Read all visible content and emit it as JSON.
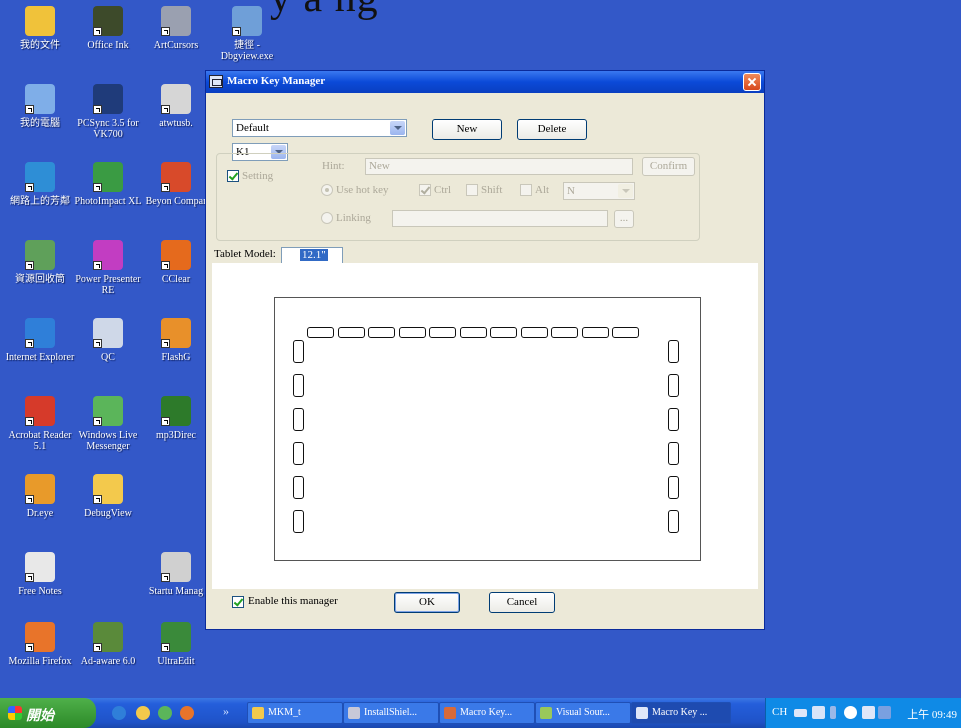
{
  "capture_top_text": "y a ng",
  "desktop_icons": [
    {
      "label": "我的文件",
      "icon": "my-documents-icon",
      "color": "#f0c23a"
    },
    {
      "label": "Office Ink",
      "icon": "office-ink-icon",
      "color": "#3d4a2a"
    },
    {
      "label": "ArtCursors",
      "icon": "artcursors-icon",
      "color": "#9aa0b0"
    },
    {
      "label": "捷徑 - Dbgview.exe",
      "icon": "dbgview-icon",
      "color": "#6f9fd8"
    },
    {
      "label": "我的電腦",
      "icon": "my-computer-icon",
      "color": "#7faee8"
    },
    {
      "label": "PCSync 3.5 for VK700",
      "icon": "pcsync-icon",
      "color": "#1f3b7a"
    },
    {
      "label": "atwtusb.",
      "icon": "atwtusb-icon",
      "color": "#d6d6d6"
    },
    {
      "label": "網路上的芳鄰",
      "icon": "network-places-icon",
      "color": "#2e8ed6"
    },
    {
      "label": "PhotoImpact XL",
      "icon": "photoimpact-icon",
      "color": "#3a9b43"
    },
    {
      "label": "Beyon Compar",
      "icon": "beyond-compare-icon",
      "color": "#d84a2a"
    },
    {
      "label": "資源回收筒",
      "icon": "recycle-bin-icon",
      "color": "#5fa05a"
    },
    {
      "label": "Power Presenter RE",
      "icon": "power-presenter-icon",
      "color": "#c23dc2"
    },
    {
      "label": "CClear",
      "icon": "ccleaner-icon",
      "color": "#e56a1d"
    },
    {
      "label": "Internet Explorer",
      "icon": "internet-explorer-icon",
      "color": "#2f7fd9"
    },
    {
      "label": "QC",
      "icon": "qc-icon",
      "color": "#cfd8e8"
    },
    {
      "label": "FlashG",
      "icon": "flashget-icon",
      "color": "#e8902a"
    },
    {
      "label": "Acrobat Reader 5.1",
      "icon": "acrobat-reader-icon",
      "color": "#d63a2a"
    },
    {
      "label": "Windows Live Messenger",
      "icon": "messenger-icon",
      "color": "#5bb55a"
    },
    {
      "label": "mp3Direc",
      "icon": "mp3directcut-icon",
      "color": "#2d7a2a"
    },
    {
      "label": "Dr.eye",
      "icon": "dreye-icon",
      "color": "#e89a2a"
    },
    {
      "label": "DebugView",
      "icon": "folder-icon",
      "color": "#f3c94c"
    },
    {
      "label": "Free Notes",
      "icon": "free-notes-icon",
      "color": "#e8e8e8"
    },
    {
      "label": "Startu Manag",
      "icon": "startup-manager-icon",
      "color": "#d0d0d0"
    },
    {
      "label": "Mozilla Firefox",
      "icon": "firefox-icon",
      "color": "#e8742a"
    },
    {
      "label": "Ad-aware 6.0",
      "icon": "adaware-icon",
      "color": "#5a8a3a"
    },
    {
      "label": "UltraEdit",
      "icon": "ultraedit-icon",
      "color": "#3a8a3a"
    }
  ],
  "dialog": {
    "title": "Macro Key Manager",
    "profile_value": "Default",
    "new_label": "New",
    "delete_label": "Delete",
    "key_value": "K1",
    "setting_label": "Setting",
    "setting_checked": true,
    "hint_label": "Hint:",
    "hint_value": "New",
    "confirm_label": "Confirm",
    "use_hot_key_label": "Use hot key",
    "ctrl_label": "Ctrl",
    "ctrl_checked": true,
    "shift_label": "Shift",
    "shift_checked": false,
    "alt_label": "Alt",
    "alt_checked": false,
    "key_select_value": "N",
    "linking_label": "Linking",
    "linking_value": "",
    "browse_label": "...",
    "tablet_model_label": "Tablet Model:",
    "tablet_model_value": "12.1\"",
    "enable_label": "Enable this manager",
    "enable_checked": true,
    "ok_label": "OK",
    "cancel_label": "Cancel"
  },
  "hotkey_layout": {
    "top_count": 11,
    "left_count": 6,
    "right_count": 6
  },
  "taskbar": {
    "start_label": "開始",
    "chevron": "»",
    "tasks": [
      {
        "label": "MKM_t",
        "icon": "folder-icon",
        "color": "#f3c94c"
      },
      {
        "label": "InstallShiel...",
        "icon": "installshield-icon",
        "color": "#c8c8d8"
      },
      {
        "label": "Macro Key...",
        "icon": "macro-key-icon",
        "color": "#d86a3a"
      },
      {
        "label": "Visual Sour...",
        "icon": "visual-sourcesafe-icon",
        "color": "#9ac85a"
      },
      {
        "label": "Macro Key ...",
        "icon": "macro-key-window-icon",
        "color": "#dfe6f8"
      }
    ],
    "tray_ime": "CH",
    "clock": "上午 09:49"
  }
}
